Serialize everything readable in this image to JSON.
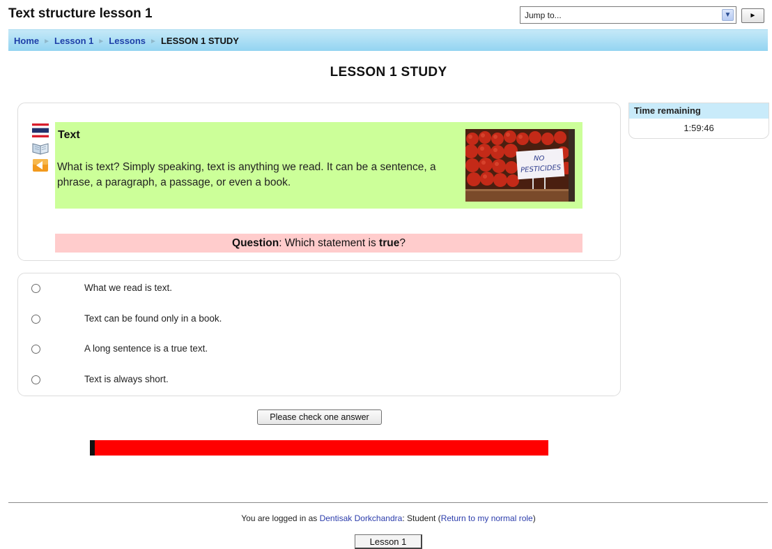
{
  "header": {
    "title": "Text structure lesson 1",
    "jump_placeholder": "Jump to...",
    "go_label": "►"
  },
  "breadcrumb": {
    "items": [
      "Home",
      "Lesson 1",
      "Lessons",
      "LESSON 1 STUDY"
    ],
    "separator": "►"
  },
  "page": {
    "title": "LESSON 1 STUDY"
  },
  "content": {
    "heading": "Text",
    "body": "What is text? Simply speaking, text is anything we read. It can be a sentence, a phrase, a paragraph, a passage, or even a book.",
    "image_sign": [
      "NO",
      "PESTICIDES"
    ],
    "icons": [
      "thai-flag-icon",
      "book-icon",
      "audio-back-icon"
    ]
  },
  "question": {
    "prefix": "Question",
    "middle": ": Which statement is ",
    "emphasis": "true",
    "suffix": "?"
  },
  "choices": [
    "What we read is text.",
    "Text can be found only in a book.",
    "A long sentence is a true text.",
    "Text is always short."
  ],
  "submit_label": "Please check one answer",
  "progress": {
    "fraction": 0.01,
    "color_fill": "#111111",
    "color_track": "#ff0000"
  },
  "timer": {
    "label": "Time remaining",
    "value": "1:59:46"
  },
  "footer": {
    "prefix": "You are logged in as ",
    "user": "Dentisak Dorkchandra",
    "middle": ": Student (",
    "return_link": "Return to my normal role",
    "suffix": ")",
    "course_button": "Lesson 1"
  },
  "colors": {
    "navbar": "#93d4f1",
    "content_panel": "#ccff99",
    "question_panel": "#ffcccc",
    "link": "#1d3fa8"
  }
}
